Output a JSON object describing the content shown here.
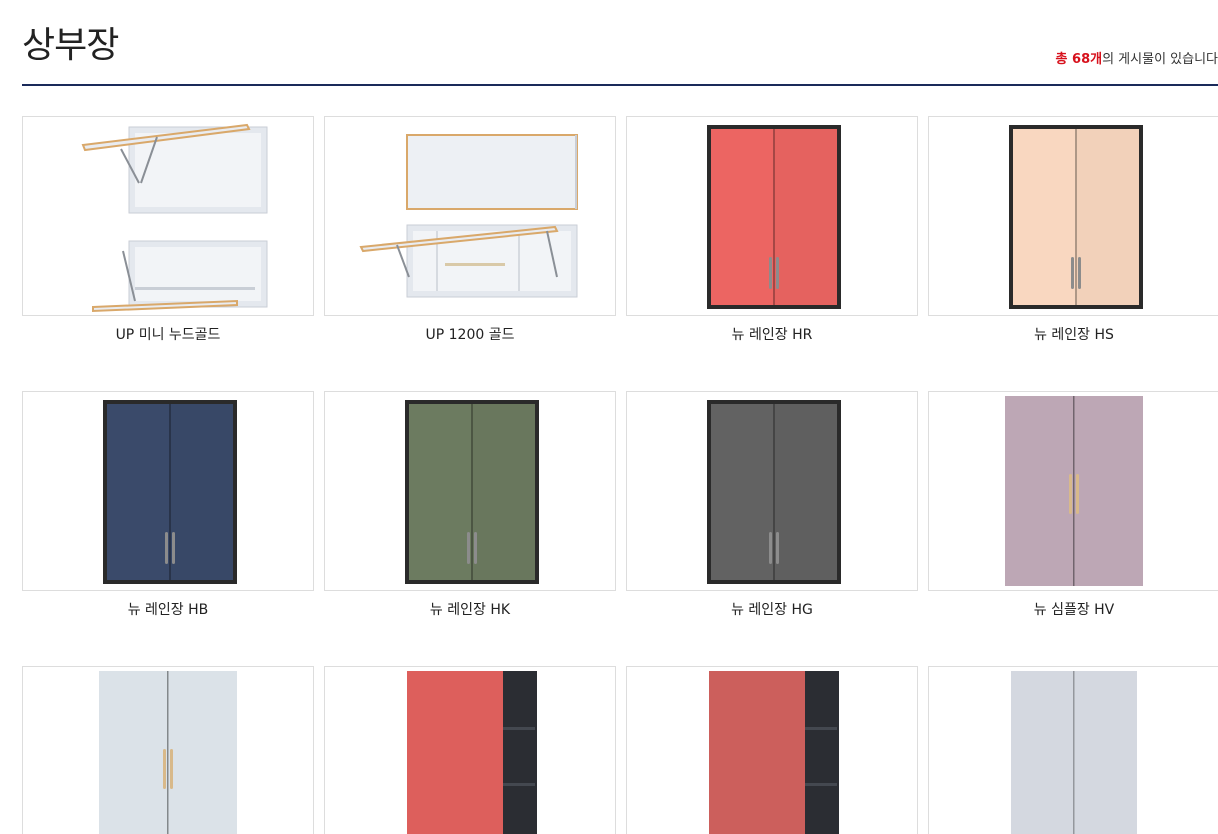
{
  "header": {
    "title": "상부장",
    "count_prefix": "총 68개",
    "count_suffix": "의 게시물이 있습니다"
  },
  "products": [
    {
      "name": "UP 미니 누드골드",
      "kind": "lift",
      "color": "#e9ecf1"
    },
    {
      "name": "UP 1200 골드",
      "kind": "lift-wide",
      "color": "#e9ecf1"
    },
    {
      "name": "뉴 레인장 HR",
      "kind": "frame",
      "color": "#ec6562"
    },
    {
      "name": "뉴 레인장 HS",
      "kind": "frame",
      "color": "#f9d7c0"
    },
    {
      "name": "뉴 레인장 HB",
      "kind": "frame",
      "color": "#3a4a6a"
    },
    {
      "name": "뉴 레인장 HK",
      "kind": "frame",
      "color": "#6c7b60"
    },
    {
      "name": "뉴 레인장 HG",
      "kind": "frame",
      "color": "#626262"
    },
    {
      "name": "뉴 심플장 HV",
      "kind": "simple",
      "color": "#bda7b5"
    },
    {
      "name": "",
      "kind": "simple",
      "color": "#dbe2e8"
    },
    {
      "name": "",
      "kind": "open-side",
      "color": "#dd5f5c"
    },
    {
      "name": "",
      "kind": "open-side",
      "color": "#cc5f5c"
    },
    {
      "name": "",
      "kind": "simple-plain",
      "color": "#d4d8e0"
    }
  ]
}
